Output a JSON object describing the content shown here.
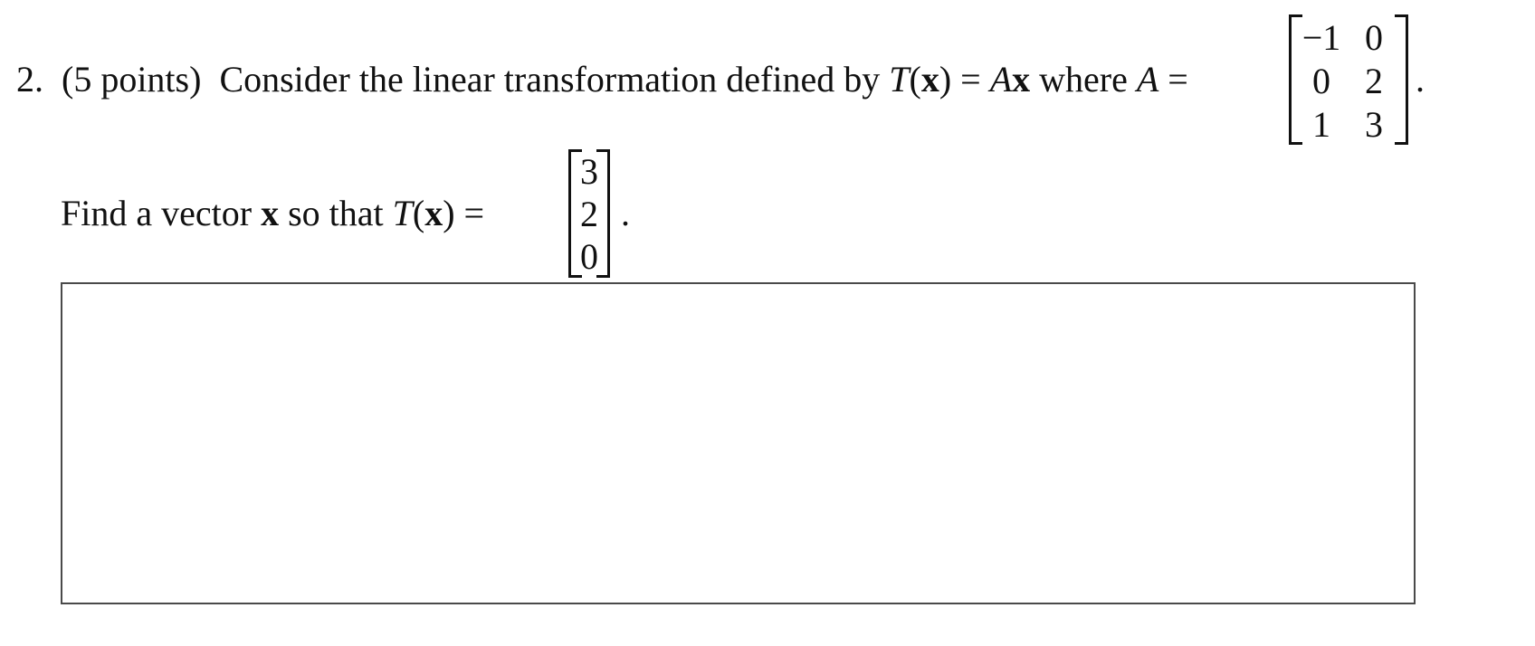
{
  "problem": {
    "number": "2.",
    "points": "(5 points)",
    "intro": "Consider the linear transformation defined by",
    "T": "T",
    "open_paren": "(",
    "x": "x",
    "close_paren": ")",
    "equals": "=",
    "A": "A",
    "where": "where",
    "period": ".",
    "matrix_A": {
      "rows": [
        [
          "−1",
          "0"
        ],
        [
          "0",
          "2"
        ],
        [
          "1",
          "3"
        ]
      ]
    },
    "question_prefix": "Find a vector",
    "question_mid": "so that",
    "target_vector": [
      "3",
      "2",
      "0"
    ]
  },
  "answer_box": {
    "value": ""
  }
}
